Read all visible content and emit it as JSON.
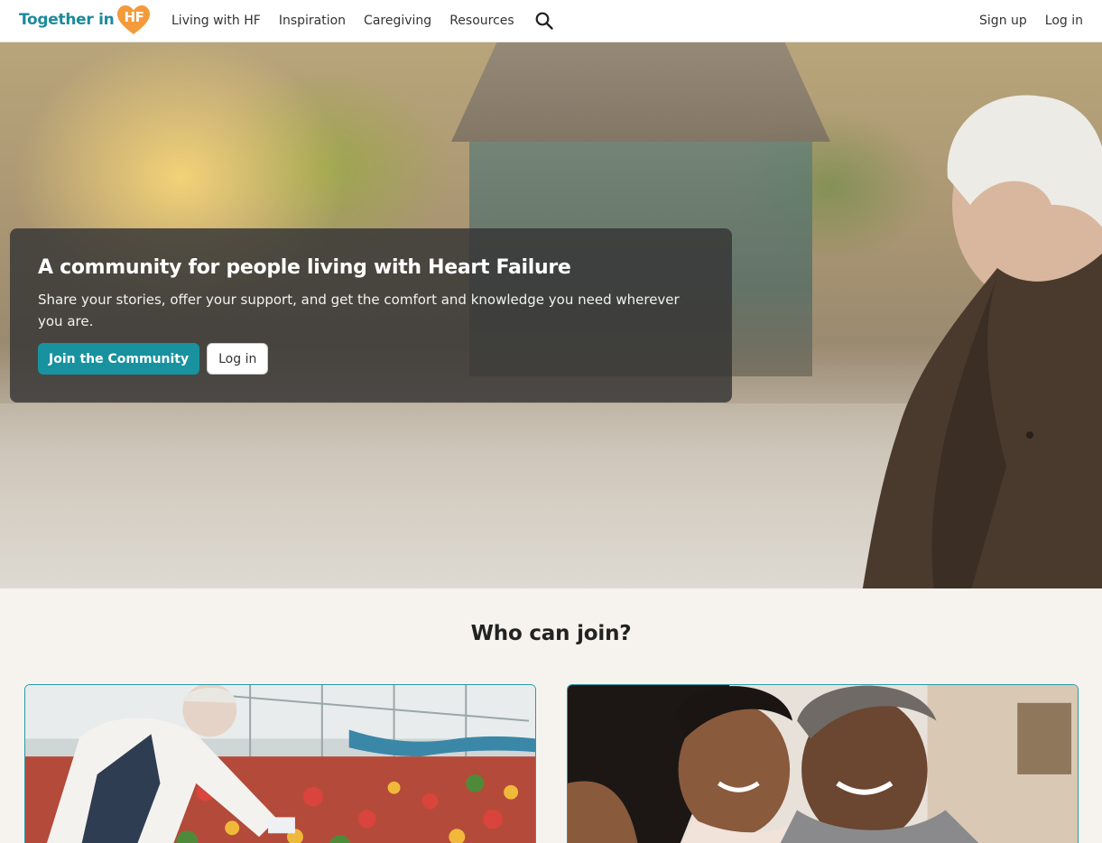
{
  "header": {
    "logo": {
      "text": "Together in",
      "badge": "HF"
    },
    "nav": [
      {
        "label": "Living with HF"
      },
      {
        "label": "Inspiration"
      },
      {
        "label": "Caregiving"
      },
      {
        "label": "Resources"
      }
    ],
    "search_icon": "search-icon",
    "auth": {
      "signup": "Sign up",
      "login": "Log in"
    }
  },
  "hero": {
    "title": "A community for people living with Heart Failure",
    "subtitle": "Share your stories, offer your support, and get the comfort and knowledge you need wherever you are.",
    "primary_button": "Join the Community",
    "secondary_button": "Log in"
  },
  "who_can_join": {
    "title": "Who can join?"
  },
  "colors": {
    "brand_teal": "#18929f",
    "logo_teal": "#1c8a9b",
    "logo_orange": "#f39a3a",
    "page_bg": "#f6f3ee"
  }
}
